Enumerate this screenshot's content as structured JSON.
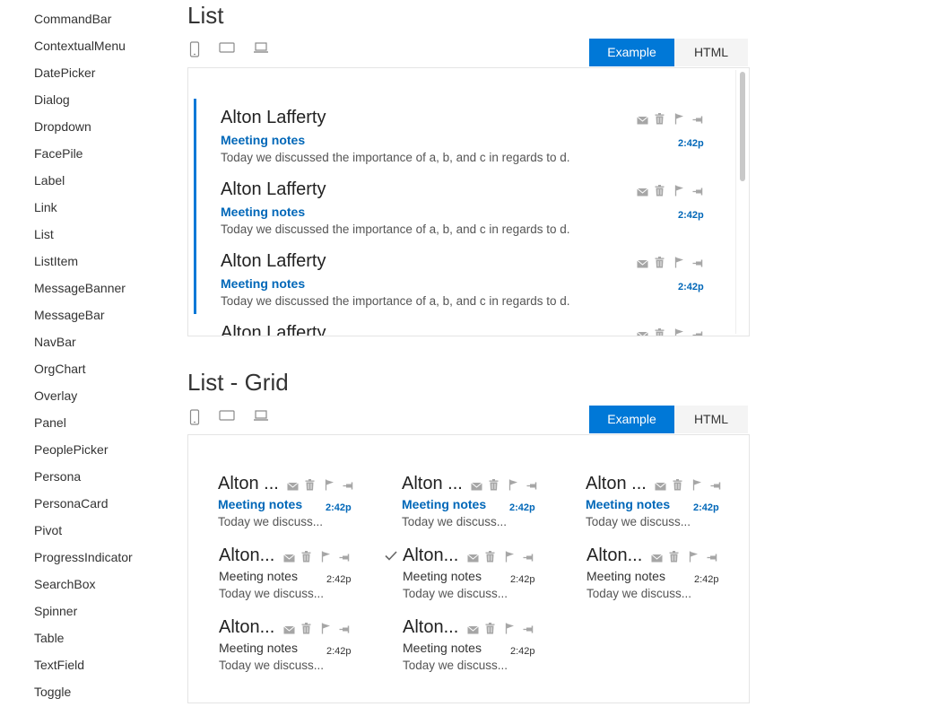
{
  "theme": {
    "accent": "#0078d7",
    "link": "#0067b8",
    "icon_gray": "#a6a6a6",
    "tab_bg": "#f4f4f4"
  },
  "sidebar": {
    "items": [
      {
        "label": "CommandBar"
      },
      {
        "label": "ContextualMenu"
      },
      {
        "label": "DatePicker"
      },
      {
        "label": "Dialog"
      },
      {
        "label": "Dropdown"
      },
      {
        "label": "FacePile"
      },
      {
        "label": "Label"
      },
      {
        "label": "Link"
      },
      {
        "label": "List"
      },
      {
        "label": "ListItem"
      },
      {
        "label": "MessageBanner"
      },
      {
        "label": "MessageBar"
      },
      {
        "label": "NavBar"
      },
      {
        "label": "OrgChart"
      },
      {
        "label": "Overlay"
      },
      {
        "label": "Panel"
      },
      {
        "label": "PeoplePicker"
      },
      {
        "label": "Persona"
      },
      {
        "label": "PersonaCard"
      },
      {
        "label": "Pivot"
      },
      {
        "label": "ProgressIndicator"
      },
      {
        "label": "SearchBox"
      },
      {
        "label": "Spinner"
      },
      {
        "label": "Table"
      },
      {
        "label": "TextField"
      },
      {
        "label": "Toggle"
      }
    ]
  },
  "device_icons": [
    "phone-icon",
    "tablet-icon",
    "laptop-icon"
  ],
  "action_icons": [
    "mail-icon",
    "trash-icon",
    "flag-icon",
    "pin-icon"
  ],
  "list_section": {
    "title": "List",
    "tabs": {
      "example": "Example",
      "html": "HTML",
      "active": "example"
    },
    "items": [
      {
        "name": "Alton Lafferty",
        "subject": "Meeting notes",
        "preview": "Today we discussed the importance of a, b, and c in regards to d.",
        "time": "2:42p"
      },
      {
        "name": "Alton Lafferty",
        "subject": "Meeting notes",
        "preview": "Today we discussed the importance of a, b, and c in regards to d.",
        "time": "2:42p"
      },
      {
        "name": "Alton Lafferty",
        "subject": "Meeting notes",
        "preview": "Today we discussed the importance of a, b, and c in regards to d.",
        "time": "2:42p"
      },
      {
        "name": "Alton Lafferty",
        "subject": "",
        "preview": "",
        "time": ""
      }
    ]
  },
  "grid_section": {
    "title": "List - Grid",
    "tabs": {
      "example": "Example",
      "html": "HTML",
      "active": "example"
    },
    "items": [
      {
        "name": "Alton ...",
        "subject": "Meeting notes",
        "preview": "Today we discuss...",
        "time": "2:42p",
        "unread": true,
        "checked": false
      },
      {
        "name": "Alton ...",
        "subject": "Meeting notes",
        "preview": "Today we discuss...",
        "time": "2:42p",
        "unread": true,
        "checked": false
      },
      {
        "name": "Alton ...",
        "subject": "Meeting notes",
        "preview": "Today we discuss...",
        "time": "2:42p",
        "unread": true,
        "checked": false
      },
      {
        "name": "Alton...",
        "subject": "Meeting notes",
        "preview": "Today we discuss...",
        "time": "2:42p",
        "unread": false,
        "checked": false
      },
      {
        "name": "Alton...",
        "subject": "Meeting notes",
        "preview": "Today we discuss...",
        "time": "2:42p",
        "unread": false,
        "checked": true
      },
      {
        "name": "Alton...",
        "subject": "Meeting notes",
        "preview": "Today we discuss...",
        "time": "2:42p",
        "unread": false,
        "checked": false
      },
      {
        "name": "Alton...",
        "subject": "Meeting notes",
        "preview": "Today we discuss...",
        "time": "2:42p",
        "unread": false,
        "checked": false
      },
      {
        "name": "Alton...",
        "subject": "Meeting notes",
        "preview": "Today we discuss...",
        "time": "2:42p",
        "unread": false,
        "checked": false
      }
    ]
  }
}
